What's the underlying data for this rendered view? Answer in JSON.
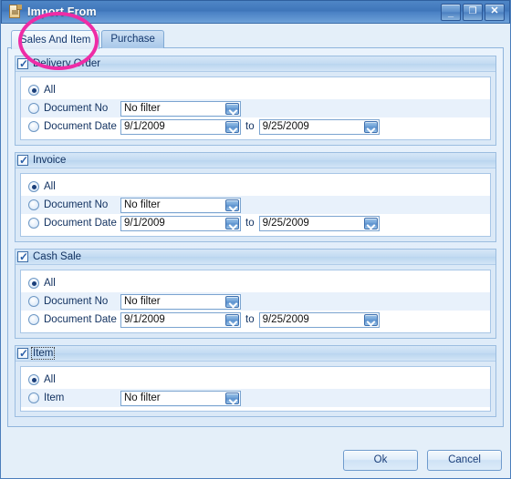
{
  "window": {
    "title": "Import From",
    "icon": "document-icon",
    "buttons": {
      "minimize": "_",
      "maximize": "❐",
      "close": "✕"
    }
  },
  "tabs": [
    {
      "label": "Sales And Item",
      "selected": true
    },
    {
      "label": "Purchase",
      "selected": false
    }
  ],
  "labels": {
    "to": "to",
    "all": "All",
    "document_no": "Document No",
    "document_date": "Document Date",
    "item": "Item"
  },
  "groups": [
    {
      "title": "Delivery Order",
      "checked": true,
      "focused": false,
      "rows": [
        {
          "type": "all",
          "label": "All",
          "selected": true
        },
        {
          "type": "filter",
          "label": "Document No",
          "selected": false,
          "value": "No filter"
        },
        {
          "type": "daterange",
          "label": "Document Date",
          "selected": false,
          "from": "9/1/2009",
          "to": "9/25/2009"
        }
      ]
    },
    {
      "title": "Invoice",
      "checked": true,
      "focused": false,
      "rows": [
        {
          "type": "all",
          "label": "All",
          "selected": true
        },
        {
          "type": "filter",
          "label": "Document No",
          "selected": false,
          "value": "No filter"
        },
        {
          "type": "daterange",
          "label": "Document Date",
          "selected": false,
          "from": "9/1/2009",
          "to": "9/25/2009"
        }
      ]
    },
    {
      "title": "Cash Sale",
      "checked": true,
      "focused": false,
      "rows": [
        {
          "type": "all",
          "label": "All",
          "selected": true
        },
        {
          "type": "filter",
          "label": "Document No",
          "selected": false,
          "value": "No filter"
        },
        {
          "type": "daterange",
          "label": "Document Date",
          "selected": false,
          "from": "9/1/2009",
          "to": "9/25/2009"
        }
      ]
    },
    {
      "title": "Item",
      "checked": true,
      "focused": true,
      "rows": [
        {
          "type": "all",
          "label": "All",
          "selected": true
        },
        {
          "type": "filter",
          "label": "Item",
          "selected": false,
          "value": "No filter"
        }
      ]
    }
  ],
  "footer": {
    "ok_label": "Ok",
    "cancel_label": "Cancel"
  },
  "annotation": {
    "shape": "ellipse",
    "color": "#ee2ca6",
    "target": "Sales And Item"
  },
  "theme": {
    "titlebar": "#3f76ba",
    "dialog_bg": "#e4eff9",
    "accent": "#2b5fa8",
    "annotation": "#ee2ca6"
  }
}
